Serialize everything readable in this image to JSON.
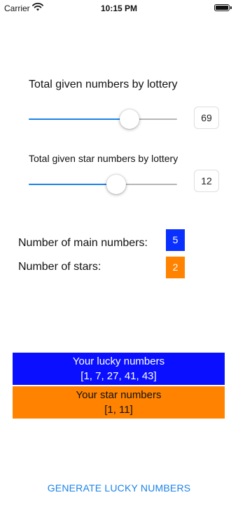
{
  "status_bar": {
    "carrier": "Carrier",
    "time": "10:15 PM",
    "wifi_icon": "wifi-icon",
    "battery_icon": "battery-icon"
  },
  "sliders": [
    {
      "label": "Total given numbers by lottery",
      "value": "69",
      "fill_fraction": 0.68
    },
    {
      "label": "Total given star numbers by lottery",
      "value": "12",
      "fill_fraction": 0.59
    }
  ],
  "counts": {
    "main_label": "Number of main numbers:",
    "main_value": "5",
    "stars_label": "Number of stars:",
    "stars_value": "2"
  },
  "results": {
    "main_title": "Your lucky numbers",
    "main_numbers": "[1, 7, 27, 41, 43]",
    "star_title": "Your star numbers",
    "star_numbers": "[1, 11]"
  },
  "generate_button_label": "GENERATE LUCKY NUMBERS",
  "colors": {
    "accent": "#1a82e8",
    "main_blue": "#0a10ff",
    "star_orange": "#ff8300"
  }
}
